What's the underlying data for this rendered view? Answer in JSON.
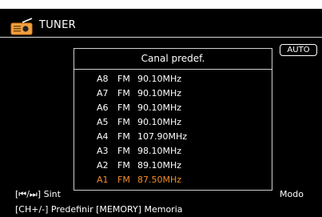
{
  "app": {
    "title": "TUNER",
    "icon": "radio-icon"
  },
  "mode_badge": "AUTO",
  "popup": {
    "title": "Canal predef.",
    "presets": [
      {
        "channel": "A8",
        "band": "FM",
        "frequency": "90.10MHz",
        "selected": false
      },
      {
        "channel": "A7",
        "band": "FM",
        "frequency": "90.10MHz",
        "selected": false
      },
      {
        "channel": "A6",
        "band": "FM",
        "frequency": "90.10MHz",
        "selected": false
      },
      {
        "channel": "A5",
        "band": "FM",
        "frequency": "90.10MHz",
        "selected": false
      },
      {
        "channel": "A4",
        "band": "FM",
        "frequency": "107.90MHz",
        "selected": false
      },
      {
        "channel": "A3",
        "band": "FM",
        "frequency": "98.10MHz",
        "selected": false
      },
      {
        "channel": "A2",
        "band": "FM",
        "frequency": "89.10MHz",
        "selected": false
      },
      {
        "channel": "A1",
        "band": "FM",
        "frequency": "87.50MHz",
        "selected": true
      }
    ]
  },
  "footer": {
    "line1": "[⏮/⏭] Sint",
    "line1_right": "Modo",
    "line2": "[CH+/-]  Predefinir   [MEMORY] Memoria"
  },
  "colors": {
    "background": "#000000",
    "text": "#ffffff",
    "selected": "#f28c28",
    "border": "#cfcfcf"
  }
}
